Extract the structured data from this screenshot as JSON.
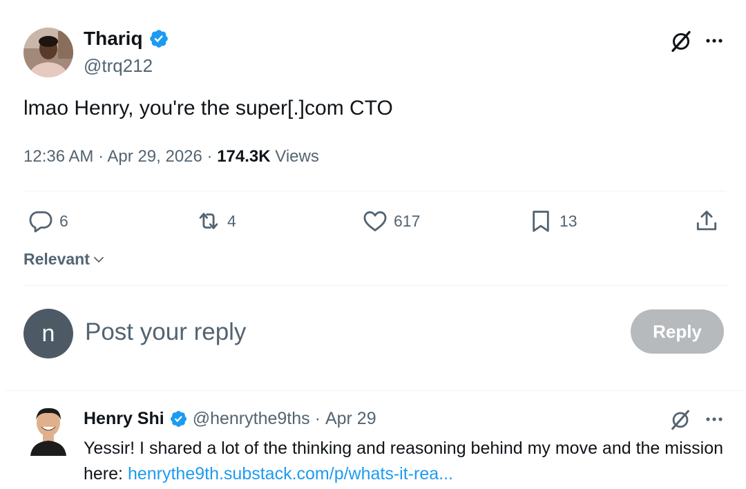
{
  "tweet": {
    "author_name": "Thariq",
    "author_handle": "@trq212",
    "text": "lmao Henry, you're the super[.]com CTO",
    "time": "12:36 AM",
    "date": "Apr 29, 2026",
    "views_count": "174.3K",
    "views_label": "Views",
    "sep": "·",
    "actions": {
      "replies": "6",
      "reposts": "4",
      "likes": "617",
      "bookmarks": "13"
    }
  },
  "sort": {
    "label": "Relevant"
  },
  "composer": {
    "avatar_letter": "n",
    "placeholder": "Post your reply",
    "button_label": "Reply"
  },
  "reply": {
    "author_name": "Henry Shi",
    "author_handle": "@henrythe9ths",
    "sep": "·",
    "date": "Apr 29",
    "text_before": "Yessir! I shared a lot of the thinking and reasoning behind my move and the mission here: ",
    "link": "henrythe9th.substack.com/p/whats-it-rea..."
  },
  "colors": {
    "verified": "#1d9bf0",
    "secondary_text": "#536471",
    "link": "#1d9bf0",
    "reply_button_disabled": "#b6babd"
  },
  "icons": [
    "verified-badge-icon",
    "grok-icon",
    "more-icon",
    "reply-icon",
    "repost-icon",
    "like-icon",
    "bookmark-icon",
    "share-icon",
    "chevron-down-icon"
  ]
}
